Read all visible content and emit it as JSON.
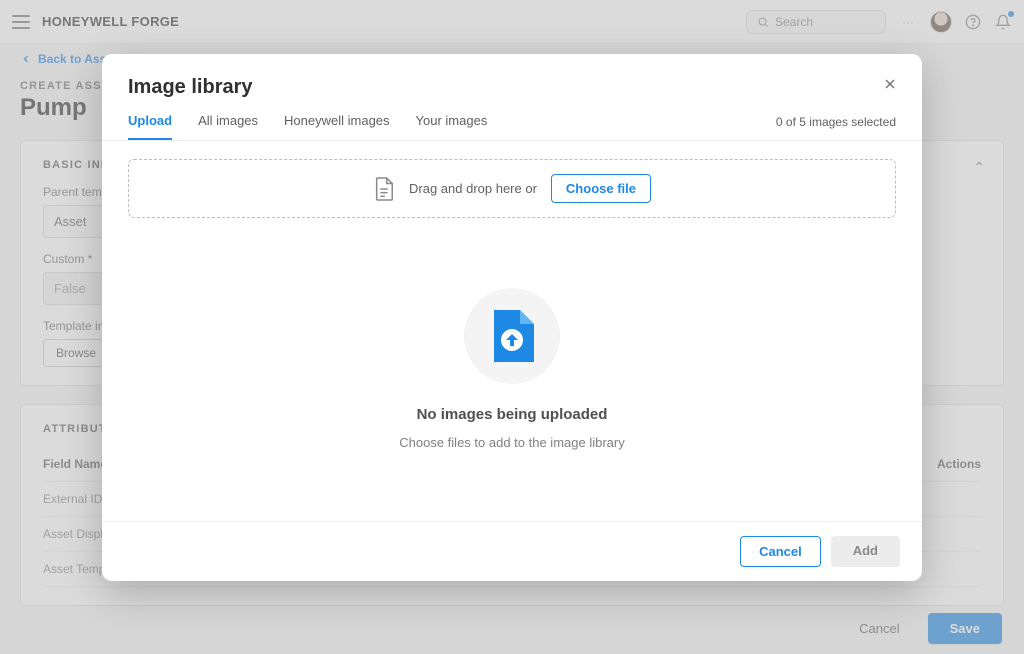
{
  "header": {
    "brand": "HONEYWELL FORGE",
    "search_placeholder": "Search"
  },
  "backlink": {
    "label": "Back to Asset Model"
  },
  "background": {
    "overline": "CREATE ASSET",
    "title": "Pump",
    "basic_info": {
      "heading": "BASIC INFO",
      "parent_label": "Parent template",
      "parent_value": "Asset",
      "custom_label": "Custom  *",
      "custom_value": "False",
      "template_image_label": "Template image",
      "browse_label": "Browse"
    },
    "attributes": {
      "heading": "ATTRIBUTES",
      "columns": {
        "field": "Field Name",
        "actions": "Actions"
      },
      "rows": [
        "External ID",
        "Asset Display Name",
        "Asset Template"
      ]
    },
    "footer": {
      "cancel": "Cancel",
      "save": "Save"
    }
  },
  "modal": {
    "title": "Image library",
    "tabs": [
      "Upload",
      "All images",
      "Honeywell images",
      "Your images"
    ],
    "active_tab_index": 0,
    "selected_text": "0 of 5 images selected",
    "dropzone": {
      "text": "Drag and drop here or",
      "choose_label": "Choose file"
    },
    "empty": {
      "title": "No images being uploaded",
      "subtitle": "Choose files to add to the image library"
    },
    "footer": {
      "cancel": "Cancel",
      "add": "Add"
    }
  }
}
